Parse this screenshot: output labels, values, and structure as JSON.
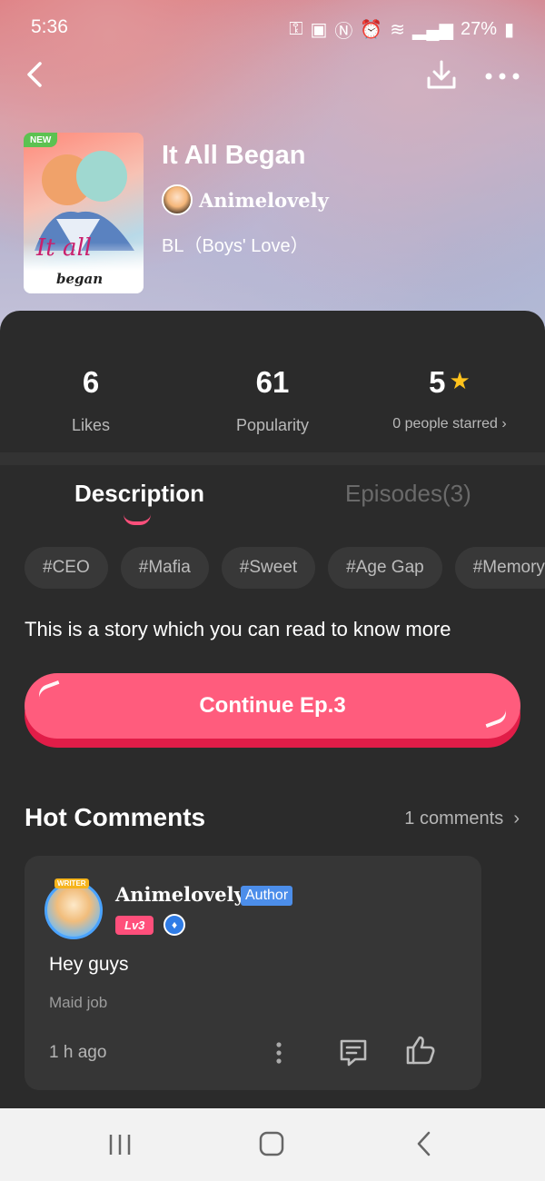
{
  "status_bar": {
    "time": "5:36",
    "battery": "27%"
  },
  "book": {
    "title": "It All Began",
    "author": "Animelovely",
    "genre": "BL（Boys' Love）",
    "cover_badge": "NEW",
    "cover_title": "It all",
    "cover_subtitle": "began"
  },
  "stats": {
    "likes_value": "6",
    "likes_label": "Likes",
    "popularity_value": "61",
    "popularity_label": "Popularity",
    "rating_value": "5",
    "rating_label": "0 people starred"
  },
  "tabs": {
    "description": "Description",
    "episodes": "Episodes(3)"
  },
  "tags": [
    "#CEO",
    "#Mafia",
    "#Sweet",
    "#Age Gap",
    "#Memory"
  ],
  "description": "This is a story which you can read to know more",
  "continue_button": "Continue Ep.3",
  "comments_section": {
    "title": "Hot Comments",
    "count": "1 comments"
  },
  "comment": {
    "avatar_label": "WRITER",
    "username": "Animelovely",
    "badge": "Author",
    "level": "Lv3",
    "text": "Hey guys",
    "subtext": "Maid job",
    "time": "1 h ago"
  },
  "colors": {
    "accent_pink": "#ff5c7d",
    "badge_blue": "#4c8eea",
    "star_yellow": "#ffc21c",
    "new_green": "#5cc251"
  }
}
